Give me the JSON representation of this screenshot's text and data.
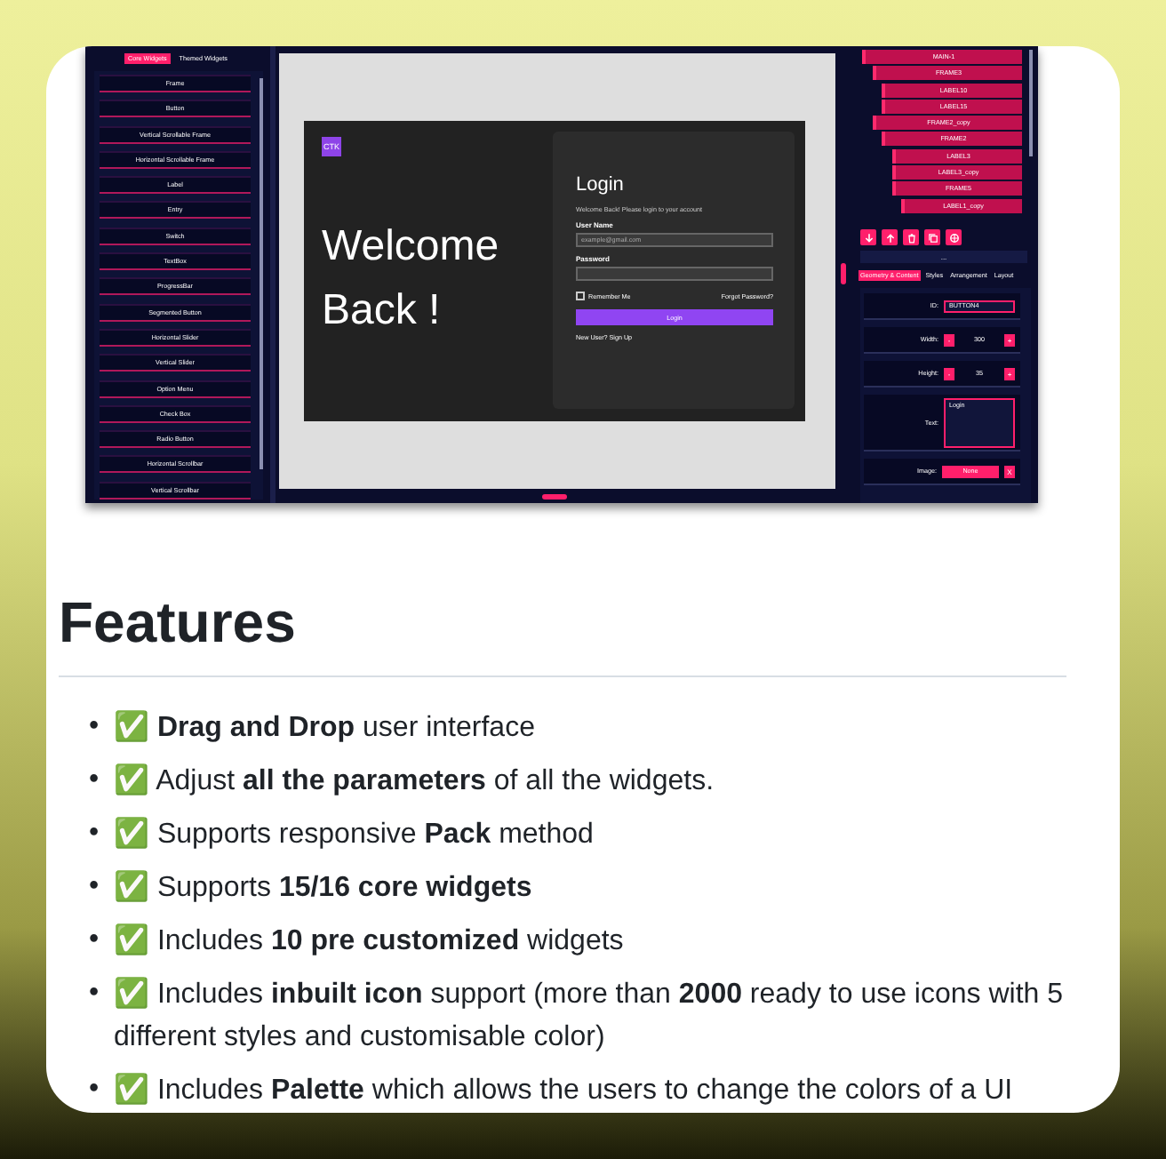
{
  "screenshot": {
    "widget_tabs": [
      {
        "label": "Core Widgets",
        "selected": true
      },
      {
        "label": "Themed Widgets",
        "selected": false
      }
    ],
    "widgets": [
      "Frame",
      "Button",
      "Vertical Scrollable Frame",
      "Horizontal Scrollable Frame",
      "Label",
      "Entry",
      "Switch",
      "TextBox",
      "ProgressBar",
      "Segmented Button",
      "Horizontal Slider",
      "Vertical Slider",
      "Option Menu",
      "Check Box",
      "Radio Button",
      "Horizontal Scrollbar",
      "Vertical Scrollbar"
    ],
    "login_screen": {
      "logo": "CTK",
      "welcome": [
        "Welcome",
        "Back !"
      ],
      "title": "Login",
      "subtitle": "Welcome Back! Please login to your account",
      "username_label": "User Name",
      "username_placeholder": "example@gmail.com",
      "password_label": "Password",
      "remember": {
        "label": "Remember Me",
        "checked": false
      },
      "forgot": "Forgot Password?",
      "button": "Login",
      "new_user": "New User? Sign Up"
    },
    "layers": [
      {
        "label": "MAIN-1",
        "children": [
          {
            "label": "FRAME3",
            "children": [
              {
                "label": "LABEL10"
              },
              {
                "label": "LABEL15"
              }
            ]
          },
          {
            "label": "FRAME2_copy",
            "children": [
              {
                "label": "FRAME2",
                "children": [
                  {
                    "label": "LABEL3"
                  },
                  {
                    "label": "LABEL3_copy"
                  },
                  {
                    "label": "FRAME5",
                    "children": [
                      {
                        "label": "LABEL1_copy"
                      }
                    ]
                  }
                ]
              }
            ]
          }
        ]
      }
    ],
    "more": "...",
    "property_tabs": [
      {
        "label": "Geometry & Content",
        "selected": true
      },
      {
        "label": "Styles",
        "selected": false
      },
      {
        "label": "Arrangement",
        "selected": false
      },
      {
        "label": "Layout",
        "selected": false
      }
    ],
    "properties": [
      {
        "kind": "field",
        "label": "ID:",
        "value": "BUTTON4"
      },
      {
        "kind": "stepper",
        "label": "Width:",
        "minus": "-",
        "value": "300",
        "plus": "+"
      },
      {
        "kind": "stepper",
        "label": "Height:",
        "minus": "-",
        "value": "35",
        "plus": "+"
      },
      {
        "kind": "textarea",
        "label": "Text:",
        "value": "Login"
      },
      {
        "kind": "dropdown",
        "label": "Image:",
        "value": "None",
        "clear": "X"
      }
    ]
  },
  "heading": "Features",
  "features": [
    {
      "bullet": "•",
      "text": "✅ **Drag and Drop** user interface"
    },
    {
      "bullet": "•",
      "text": "✅ Adjust **all the parameters** of all the widgets."
    },
    {
      "bullet": "•",
      "text": "✅ Supports responsive **Pack** method"
    },
    {
      "bullet": "•",
      "text": "✅ Supports **15/16 core widgets**"
    },
    {
      "bullet": "•",
      "text": "✅ Includes **10 pre customized** widgets"
    },
    {
      "bullet": "•",
      "text": "✅ Includes **inbuilt icon** support (more than **2000** ready to use icons with 5 different styles and customisable color)"
    },
    {
      "bullet": "•",
      "text": "✅ Includes **Palette** which allows the users to change the colors of a UI"
    }
  ]
}
